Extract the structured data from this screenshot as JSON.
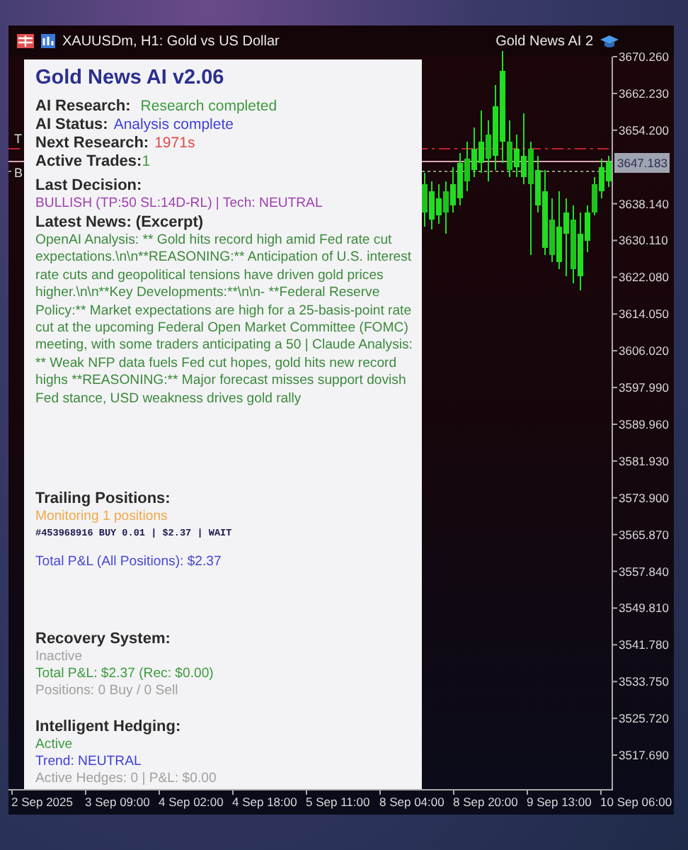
{
  "window": {
    "title": "XAUUSDm, H1:  Gold vs US Dollar",
    "expert": "Gold News AI 2"
  },
  "chart": {
    "chart_data": {
      "type": "candlestick",
      "ylim": [
        3510.58,
        3670.26
      ],
      "categories": [
        null,
        null,
        null,
        null,
        null,
        null,
        null,
        null,
        null,
        null,
        null,
        null,
        null,
        null,
        null,
        null,
        null,
        null,
        null,
        null,
        null,
        null,
        null,
        null,
        null,
        null,
        null
      ],
      "yticks": [
        {
          "value": 3670.26,
          "label": "3670.260"
        },
        {
          "value": 3662.23,
          "label": "3662.230"
        },
        {
          "value": 3654.2,
          "label": "3654.200"
        },
        {
          "value": 3638.14,
          "label": "3638.140"
        },
        {
          "value": 3630.11,
          "label": "3630.110"
        },
        {
          "value": 3622.08,
          "label": "3622.080"
        },
        {
          "value": 3614.05,
          "label": "3614.050"
        },
        {
          "value": 3606.02,
          "label": "3606.020"
        },
        {
          "value": 3597.99,
          "label": "3597.990"
        },
        {
          "value": 3589.96,
          "label": "3589.960"
        },
        {
          "value": 3581.93,
          "label": "3581.930"
        },
        {
          "value": 3573.9,
          "label": "3573.900"
        },
        {
          "value": 3565.87,
          "label": "3565.870"
        },
        {
          "value": 3557.84,
          "label": "3557.840"
        },
        {
          "value": 3549.81,
          "label": "3549.810"
        },
        {
          "value": 3541.78,
          "label": "3541.780"
        },
        {
          "value": 3533.75,
          "label": "3533.750"
        },
        {
          "value": 3525.72,
          "label": "3525.720"
        },
        {
          "value": 3517.69,
          "label": "3517.690"
        }
      ],
      "ohlc": [
        [
          3642.41,
          3644.88,
          3633.13,
          3636.22
        ],
        [
          3634.67,
          3643.03,
          3632.51,
          3640.86
        ],
        [
          3635.6,
          3642.41,
          3633.75,
          3639.32
        ],
        [
          3640.86,
          3643.03,
          3631.58,
          3636.22
        ],
        [
          3637.77,
          3646.12,
          3636.22,
          3642.41
        ],
        [
          3639.32,
          3649.22,
          3637.77,
          3647.05
        ],
        [
          3647.98,
          3651.69,
          3640.86,
          3643.03
        ],
        [
          3645.5,
          3654.79,
          3643.96,
          3650.15
        ],
        [
          3647.05,
          3658.5,
          3644.88,
          3651.69
        ],
        [
          3653.24,
          3656.33,
          3643.03,
          3647.98
        ],
        [
          3648.6,
          3664.07,
          3645.5,
          3659.43
        ],
        [
          3651.69,
          3671.5,
          3647.05,
          3667.17
        ],
        [
          3651.69,
          3656.33,
          3643.96,
          3645.5
        ],
        [
          3646.12,
          3653.24,
          3643.96,
          3650.15
        ],
        [
          3643.96,
          3657.88,
          3642.41,
          3648.6
        ],
        [
          3650.15,
          3651.69,
          3626.94,
          3642.41
        ],
        [
          3637.77,
          3648.6,
          3636.22,
          3645.5
        ],
        [
          3628.49,
          3645.5,
          3626.94,
          3640.86
        ],
        [
          3634.67,
          3639.32,
          3625.39,
          3626.94
        ],
        [
          3625.39,
          3640.86,
          3623.84,
          3633.13
        ],
        [
          3631.58,
          3639.32,
          3622.3,
          3636.22
        ],
        [
          3634.67,
          3637.77,
          3620.75,
          3623.84
        ],
        [
          3622.3,
          3636.22,
          3619.2,
          3631.58
        ],
        [
          3630.03,
          3637.77,
          3627.56,
          3636.22
        ],
        [
          3642.41,
          3643.96,
          3635.6,
          3636.22
        ],
        [
          3640.86,
          3647.98,
          3639.32,
          3646.12
        ],
        [
          3643.03,
          3648.6,
          3641.79,
          3647.36
        ]
      ]
    }
  },
  "line_labels": [
    {
      "label": "T",
      "kind": "take"
    },
    {
      "label": "B",
      "kind": "bid"
    }
  ],
  "current_price": {
    "label": "3647.183"
  },
  "time_axis": [
    "2 Sep 2025",
    "3 Sep 09:00",
    "4 Sep 02:00",
    "4 Sep 18:00",
    "5 Sep 11:00",
    "8 Sep 04:00",
    "8 Sep 20:00",
    "9 Sep 13:00",
    "10 Sep 06:00"
  ],
  "panel": {
    "title": "Gold News AI v2.06",
    "status_rows": [
      {
        "label": "AI Research:",
        "value": "Research completed",
        "kind": "research"
      },
      {
        "label": "AI Status:",
        "value": "Analysis complete",
        "kind": "status"
      },
      {
        "label": "Next Research:",
        "value": "1971s",
        "kind": "countdown"
      },
      {
        "label": "Active Trades:",
        "value": "1",
        "kind": "count"
      }
    ],
    "last_decision": {
      "label": "Last Decision:",
      "value": "BULLISH (TP:50 SL:14D-RL) | Tech: NEUTRAL"
    },
    "news": {
      "label": "Latest News: (Excerpt)",
      "text": "OpenAI Analysis: ** Gold hits record high amid Fed rate cut expectations.\\n\\n**REASONING:** Anticipation of U.S. interest rate cuts and geopolitical tensions have driven gold prices higher.\\n\\n**Key Developments:**\\n\\n- **Federal Reserve Policy:** Market expectations are high for a 25-basis-point rate cut at the upcoming Federal Open Market Committee (FOMC) meeting, with some traders anticipating a 50 | Claude Analysis: ** Weak NFP data fuels Fed cut hopes, gold hits new record highs **REASONING:** Major forecast misses support dovish Fed stance, USD weakness drives gold rally"
    },
    "trailing": {
      "label": "Trailing Positions:",
      "status": "Monitoring 1 positions",
      "position": "#453968916 BUY 0.01 | $2.37 | WAIT",
      "total": "Total P&L (All Positions): $2.37"
    },
    "recovery": {
      "label": "Recovery System:",
      "active": false,
      "state": "Inactive",
      "total": "Total P&L: $2.37 (Rec: $0.00)",
      "positions": "Positions: 0 Buy / 0 Sell"
    },
    "hedging": {
      "label": "Intelligent Hedging:",
      "active": true,
      "state": "Active",
      "trend": "Trend: NEUTRAL",
      "hedges": "Active Hedges: 0 | P&L: $0.00"
    }
  }
}
